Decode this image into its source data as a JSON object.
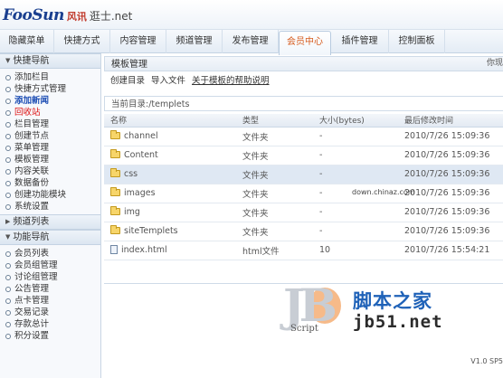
{
  "logo": {
    "main": "FooSun",
    "cn": "风讯",
    "net": "逛士.net"
  },
  "nav": [
    {
      "label": "隐藏菜单",
      "width": 60
    },
    {
      "label": "快捷方式",
      "width": 62
    },
    {
      "label": "内容管理",
      "width": 62
    },
    {
      "label": "频道管理",
      "width": 62
    },
    {
      "label": "发布管理",
      "width": 62
    },
    {
      "label": "会员中心",
      "width": 58,
      "active": true
    },
    {
      "label": "插件管理",
      "width": 64
    },
    {
      "label": "控制面板",
      "width": 62
    }
  ],
  "sidebar": {
    "section1": "快捷导航",
    "items1": [
      {
        "label": "添加栏目",
        "style": ""
      },
      {
        "label": "快捷方式管理",
        "style": ""
      },
      {
        "label": "添加新闻",
        "style": "hl"
      },
      {
        "label": "回收站",
        "style": "red"
      },
      {
        "label": "栏目管理",
        "style": ""
      },
      {
        "label": "创建节点",
        "style": ""
      },
      {
        "label": "菜单管理",
        "style": ""
      },
      {
        "label": "模板管理",
        "style": ""
      },
      {
        "label": "内容关联",
        "style": ""
      },
      {
        "label": "数据备份",
        "style": ""
      },
      {
        "label": "创建功能模块",
        "style": ""
      },
      {
        "label": "系统设置",
        "style": ""
      }
    ],
    "section2": "频道列表",
    "section3": "功能导航",
    "items3": [
      {
        "label": "会员列表"
      },
      {
        "label": "会员组管理"
      },
      {
        "label": "讨论组管理"
      },
      {
        "label": "公告管理"
      },
      {
        "label": "点卡管理"
      },
      {
        "label": "交易记录"
      },
      {
        "label": "存款总计"
      },
      {
        "label": "积分设置"
      }
    ]
  },
  "main": {
    "panel_title": "模板管理",
    "panel_title_right": "你现",
    "toolbar": {
      "new_dir": "创建目录",
      "import": "导入文件",
      "help": "关于模板的帮助说明"
    },
    "path": "当前目录:/templets",
    "columns": [
      "名称",
      "类型",
      "大小(bytes)",
      "最后修改时间"
    ],
    "rows": [
      {
        "icon": "folder",
        "name": "channel",
        "type": "文件夹",
        "size": "-",
        "time": "2010/7/26 15:09:36"
      },
      {
        "icon": "folder",
        "name": "Content",
        "type": "文件夹",
        "size": "-",
        "time": "2010/7/26 15:09:36"
      },
      {
        "icon": "folder",
        "name": "css",
        "type": "文件夹",
        "size": "-",
        "time": "2010/7/26 15:09:36",
        "selected": true
      },
      {
        "icon": "folder",
        "name": "images",
        "type": "文件夹",
        "size": "-",
        "time": "2010/7/26 15:09:36"
      },
      {
        "icon": "folder",
        "name": "img",
        "type": "文件夹",
        "size": "-",
        "time": "2010/7/26 15:09:36"
      },
      {
        "icon": "folder",
        "name": "siteTemplets",
        "type": "文件夹",
        "size": "-",
        "time": "2010/7/26 15:09:36"
      },
      {
        "icon": "file",
        "name": "index.html",
        "type": "html文件",
        "size": "10",
        "time": "2010/7/26 15:54:21"
      }
    ],
    "status_right": "V1.0 SP5"
  },
  "watermark": {
    "down": "down.chinaz.com",
    "jb_letters": "JB",
    "jb_script": "Script",
    "jb_cn": "脚本之家",
    "jb_url": "jb51.net"
  },
  "colors": {
    "accent": "#d65b1d",
    "nav_bg": "#e4ecf5",
    "selected_row": "#dfe8f3",
    "watermark_blue": "#1f62b8"
  }
}
